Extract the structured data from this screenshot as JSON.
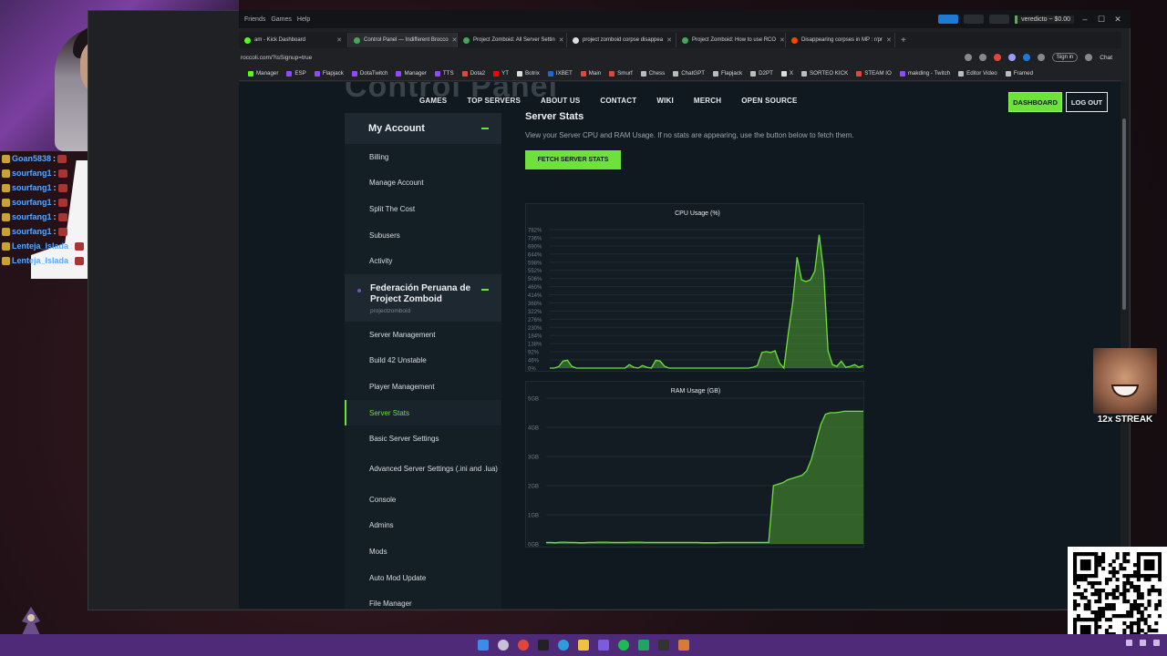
{
  "browser": {
    "top_menu": [
      "Friends",
      "Games",
      "Help"
    ],
    "user_chip": "veredicto ~ $0.00",
    "tabs": [
      {
        "label": "am - Kick Dashboard",
        "color": "#53fc18"
      },
      {
        "label": "Control Panel — Indifferent Brocco",
        "color": "#48a55a"
      },
      {
        "label": "Project Zomboid: All Server Settin",
        "color": "#48a55a"
      },
      {
        "label": "project zomboid corpse disappea",
        "color": "#dddddd"
      },
      {
        "label": "Project Zomboid: How to use RCO",
        "color": "#48a55a"
      },
      {
        "label": "Disappearing corpses in MP : r/pr",
        "color": "#ff4500"
      }
    ],
    "url": "roccoli.com/?isSignup=true",
    "sign_in": "Sign in",
    "chat_label": "Chat",
    "bookmarks": [
      {
        "label": "Manager",
        "color": "#53fc18"
      },
      {
        "label": "ESP",
        "color": "#9146ff"
      },
      {
        "label": "Flapjack",
        "color": "#9146ff"
      },
      {
        "label": "DotaTwitch",
        "color": "#9146ff"
      },
      {
        "label": "Manager",
        "color": "#9146ff"
      },
      {
        "label": "TTS",
        "color": "#9146ff"
      },
      {
        "label": "Dota2",
        "color": "#e2463a"
      },
      {
        "label": "YT",
        "color": "#ff0000"
      },
      {
        "label": "Botrix",
        "color": "#dddddd"
      },
      {
        "label": "IXBET",
        "color": "#1b6ad1"
      },
      {
        "label": "Main",
        "color": "#e2463a"
      },
      {
        "label": "Smurf",
        "color": "#e2463a"
      },
      {
        "label": "Chess",
        "color": "#bbbbbb"
      },
      {
        "label": "ChatGPT",
        "color": "#bbbbbb"
      },
      {
        "label": "Flapjack",
        "color": "#bbbbbb"
      },
      {
        "label": "D2PT",
        "color": "#bbbbbb"
      },
      {
        "label": "X",
        "color": "#dddddd"
      },
      {
        "label": "SORTEO KICK",
        "color": "#bbbbbb"
      },
      {
        "label": "STEAM IO",
        "color": "#e2463a"
      },
      {
        "label": "makding - Twitch",
        "color": "#9146ff"
      },
      {
        "label": "Editor Video",
        "color": "#bbbbbb"
      },
      {
        "label": "Framed",
        "color": "#bbbbbb"
      }
    ]
  },
  "page": {
    "big_title": "Control Panel",
    "nav": [
      "GAMES",
      "TOP SERVERS",
      "ABOUT US",
      "CONTACT",
      "WIKI",
      "MERCH",
      "OPEN SOURCE"
    ],
    "dashboard_button": "DASHBOARD",
    "logout_button": "LOG OUT",
    "sidebar": {
      "account_header": "My Account",
      "account_items": [
        "Billing",
        "Manage Account",
        "Split The Cost",
        "Subusers",
        "Activity"
      ],
      "server_name": "Federación Peruana de Project Zomboid",
      "server_sub": "projectzomboid",
      "server_items": [
        "Server Management",
        "Build 42 Unstable",
        "Player Management",
        "Server Stats",
        "Basic Server Settings",
        "Advanced Server Settings (.ini and .lua)",
        "Console",
        "Admins",
        "Mods",
        "Auto Mod Update",
        "File Manager"
      ],
      "active_item": "Server Stats"
    },
    "content": {
      "heading": "Server Stats",
      "description": "View your Server CPU and RAM Usage. If no stats are appearing, use the button below to fetch them.",
      "fetch_button": "FETCH SERVER STATS"
    }
  },
  "overlay": {
    "streak": "12x STREAK",
    "chat": [
      {
        "user": "Goan5838",
        "color": "#5aa7ff"
      },
      {
        "user": "sourfang1",
        "color": "#5aa7ff"
      },
      {
        "user": "sourfang1",
        "color": "#5aa7ff"
      },
      {
        "user": "sourfang1",
        "color": "#5aa7ff"
      },
      {
        "user": "sourfang1",
        "color": "#5aa7ff"
      },
      {
        "user": "sourfang1",
        "color": "#5aa7ff"
      },
      {
        "user": "Lenteja_Islada",
        "color": "#5aa7ff"
      },
      {
        "user": "Lenteja_Islada",
        "color": "#5aa7ff"
      }
    ]
  },
  "colors": {
    "accent": "#6ce23a",
    "page_bg": "#111920",
    "taskbar": "#4e2a78"
  },
  "chart_data": [
    {
      "type": "area",
      "title": "CPU Usage (%)",
      "ylabel": "",
      "y_ticks": [
        "782%",
        "736%",
        "690%",
        "644%",
        "598%",
        "552%",
        "506%",
        "460%",
        "414%",
        "368%",
        "322%",
        "276%",
        "230%",
        "184%",
        "138%",
        "92%",
        "46%",
        "0%"
      ],
      "ylim": [
        0,
        800
      ],
      "values": [
        0,
        0,
        8,
        40,
        45,
        10,
        0,
        0,
        0,
        0,
        0,
        0,
        0,
        0,
        0,
        0,
        0,
        0,
        20,
        5,
        0,
        15,
        5,
        0,
        45,
        40,
        10,
        0,
        0,
        0,
        0,
        0,
        0,
        0,
        0,
        0,
        0,
        0,
        0,
        0,
        0,
        0,
        0,
        0,
        0,
        0,
        5,
        15,
        90,
        95,
        90,
        100,
        30,
        0,
        200,
        380,
        640,
        510,
        500,
        510,
        560,
        770,
        560,
        100,
        20,
        10,
        40,
        5,
        10,
        20,
        5,
        15
      ],
      "line_color": "#6ce23a"
    },
    {
      "type": "area",
      "title": "RAM Usage (GB)",
      "ylabel": "",
      "y_ticks": [
        "5GB",
        "4GB",
        "3GB",
        "2GB",
        "1GB",
        "0GB"
      ],
      "ylim": [
        0,
        5
      ],
      "values": [
        0.05,
        0.05,
        0.04,
        0.06,
        0.06,
        0.05,
        0.05,
        0.04,
        0.04,
        0.05,
        0.05,
        0.06,
        0.06,
        0.06,
        0.05,
        0.05,
        0.05,
        0.05,
        0.06,
        0.06,
        0.06,
        0.05,
        0.05,
        0.05,
        0.05,
        0.05,
        0.05,
        0.05,
        0.05,
        0.05,
        0.05,
        0.05,
        0.05,
        0.04,
        0.04,
        0.04,
        0.04,
        0.05,
        0.05,
        0.05,
        0.05,
        0.05,
        0.05,
        0.05,
        0.05,
        0.05,
        0.05,
        0.05,
        2.0,
        2.05,
        2.1,
        2.2,
        2.25,
        2.3,
        2.35,
        2.5,
        2.9,
        3.5,
        4.1,
        4.45,
        4.5,
        4.5,
        4.52,
        4.55,
        4.55,
        4.55,
        4.55,
        4.55
      ],
      "line_color": "#6ce23a"
    }
  ]
}
